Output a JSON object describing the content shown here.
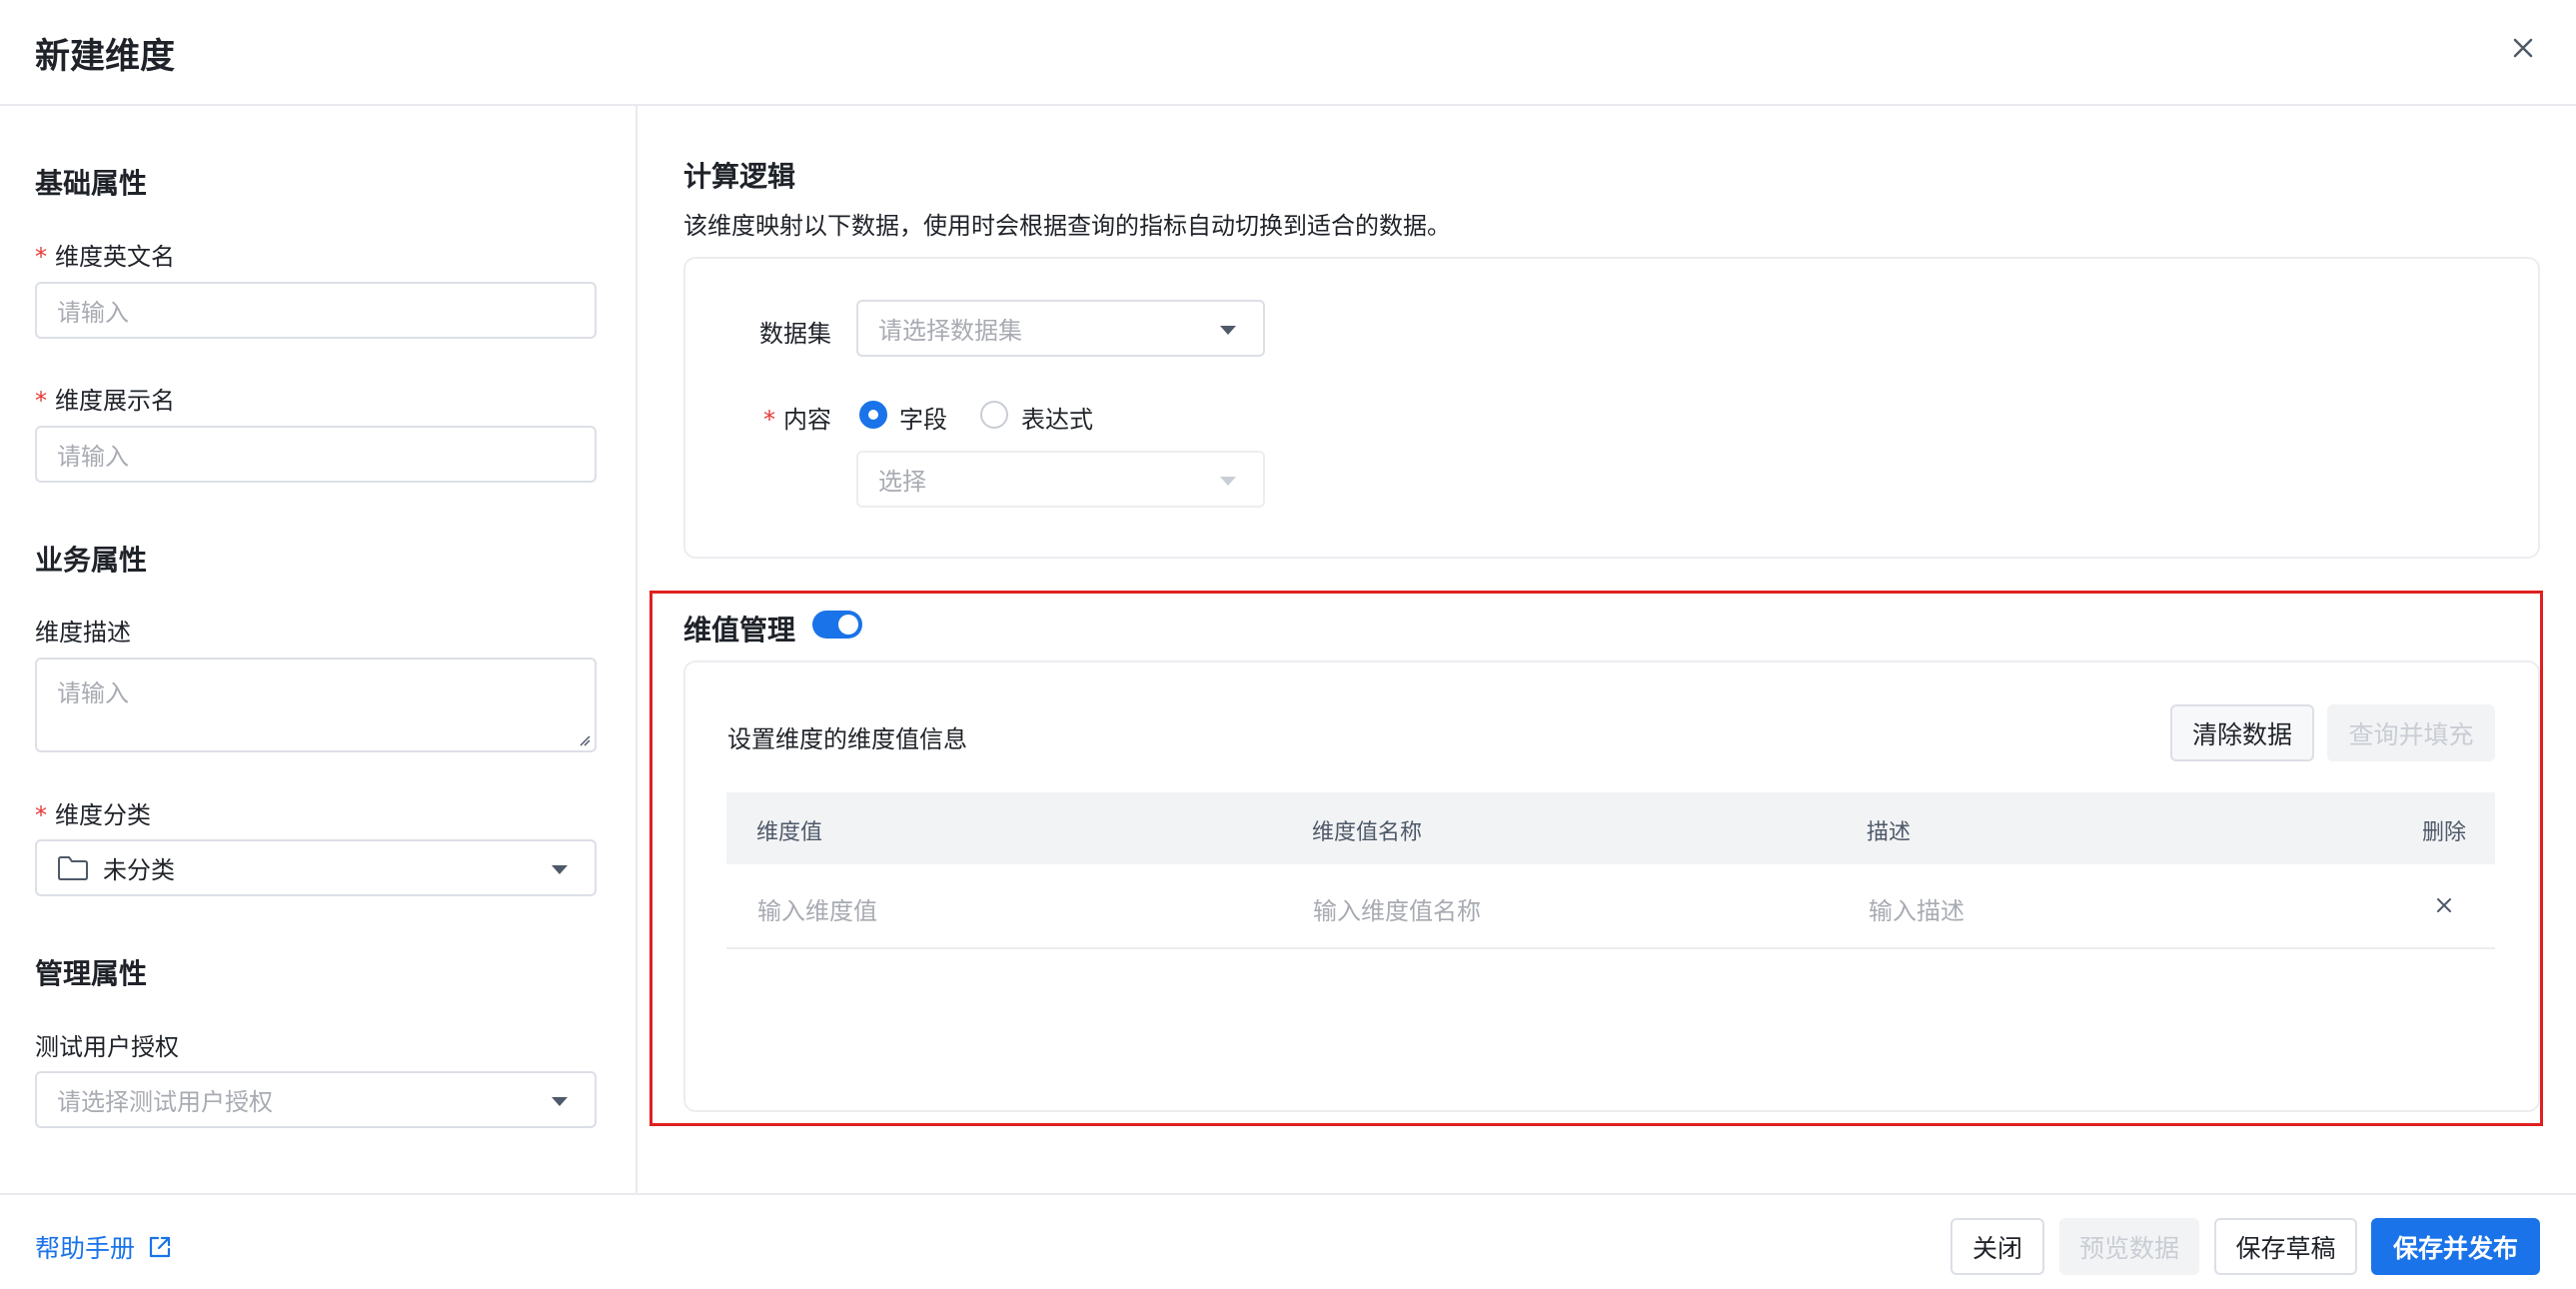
{
  "dialog": {
    "title": "新建维度"
  },
  "left": {
    "basic_title": "基础属性",
    "en_name_label": "维度英文名",
    "en_name_placeholder": "请输入",
    "display_name_label": "维度展示名",
    "display_name_placeholder": "请输入",
    "business_title": "业务属性",
    "desc_label": "维度描述",
    "desc_placeholder": "请输入",
    "category_label": "维度分类",
    "category_value": "未分类",
    "manage_title": "管理属性",
    "auth_label": "测试用户授权",
    "auth_placeholder": "请选择测试用户授权",
    "required_mark": "*"
  },
  "logic": {
    "title": "计算逻辑",
    "description": "该维度映射以下数据，使用时会根据查询的指标自动切换到适合的数据。",
    "dataset_label": "数据集",
    "dataset_placeholder": "请选择数据集",
    "content_label": "内容",
    "radio_field": "字段",
    "radio_expression": "表达式",
    "field_select_placeholder": "选择"
  },
  "dim_values": {
    "title": "维值管理",
    "toggle_on": true,
    "info": "设置维度的维度值信息",
    "clear_button": "清除数据",
    "query_fill_button": "查询并填充",
    "columns": [
      "维度值",
      "维度值名称",
      "描述",
      "删除"
    ],
    "row_placeholders": [
      "输入维度值",
      "输入维度值名称",
      "输入描述"
    ]
  },
  "footer": {
    "help": "帮助手册",
    "close": "关闭",
    "preview": "预览数据",
    "save_draft": "保存草稿",
    "save_publish": "保存并发布"
  },
  "colors": {
    "accent": "#1a73e8",
    "highlight": "#e02020",
    "required": "#e53935"
  }
}
